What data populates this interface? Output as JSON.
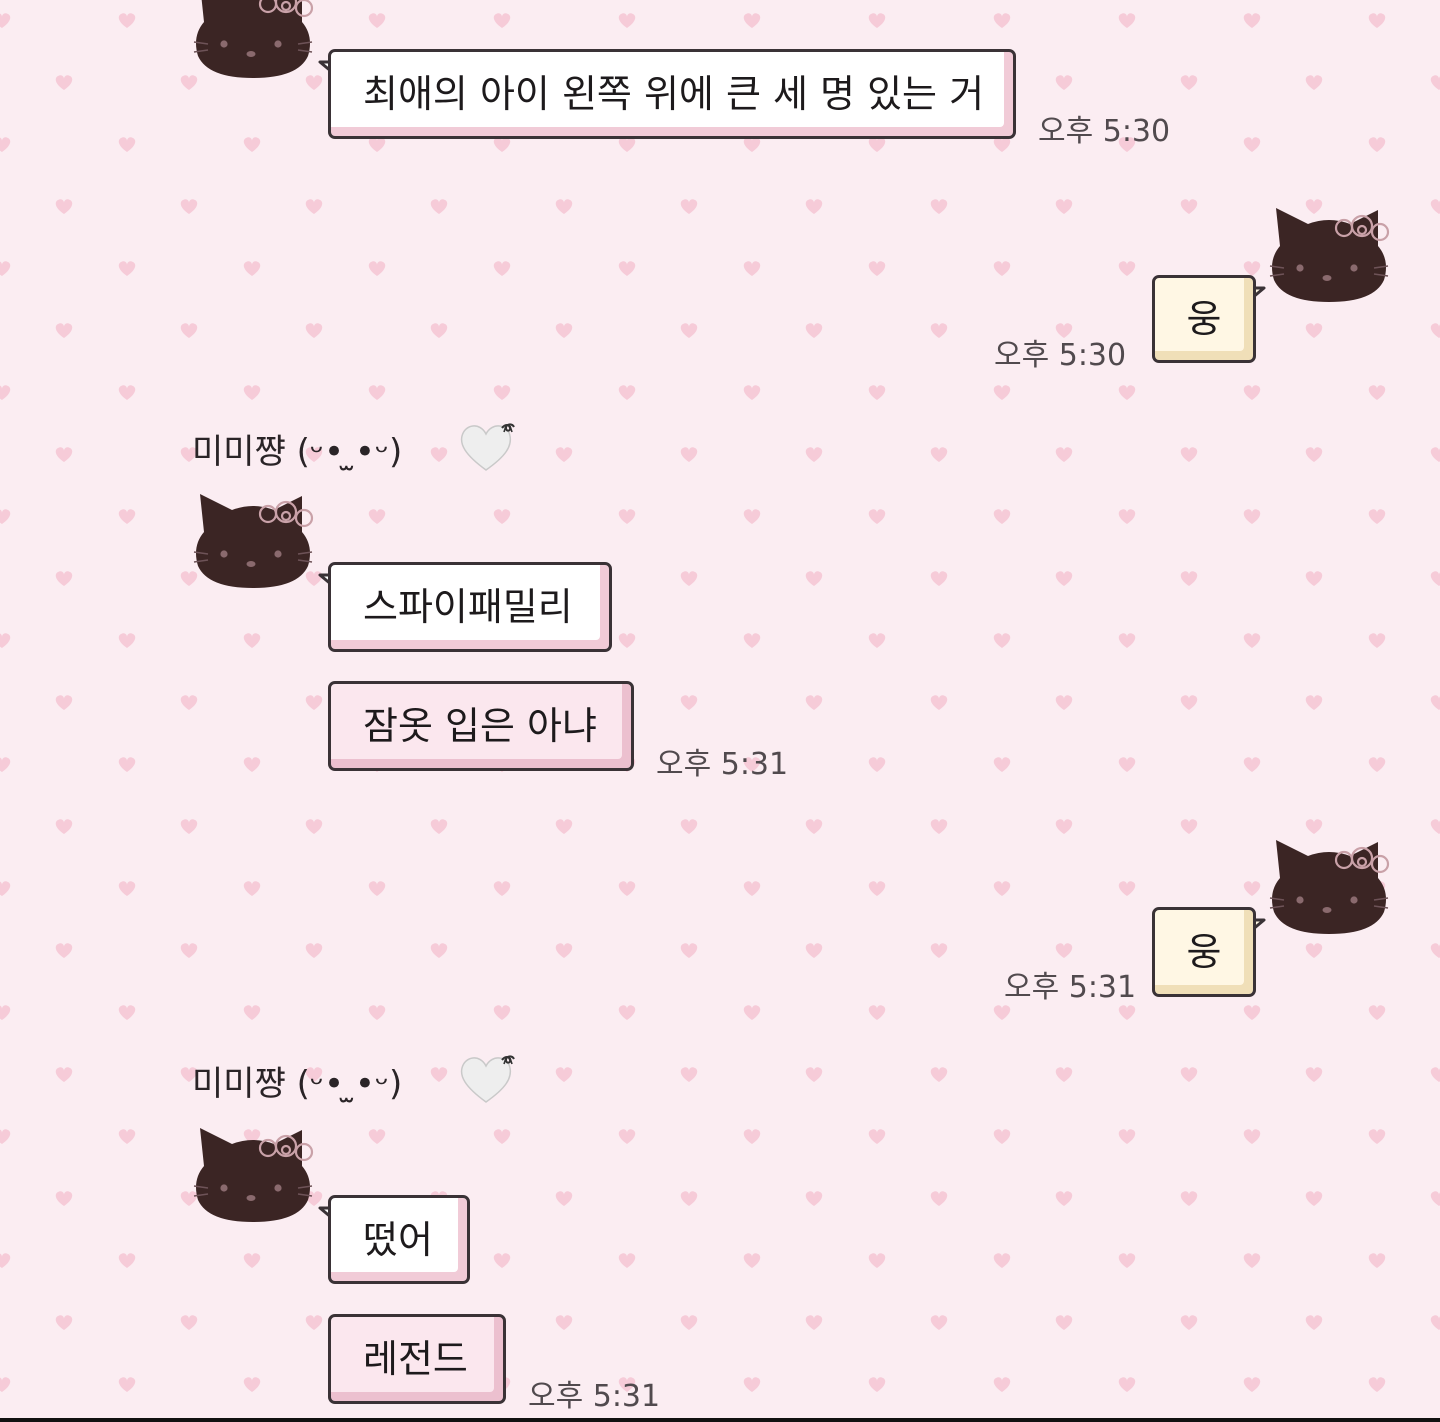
{
  "theme": {
    "background": "#fbedf2",
    "pattern_heart": "#f6cbd8",
    "avatar_color": "#3b2524",
    "bubble_border": "#3a3236"
  },
  "messages": [
    {
      "id": "m1",
      "side": "left",
      "style": "white",
      "text": "최애의 아이 왼쪽 위에 큰 세 명 있는 거",
      "time": "오후 5:30"
    },
    {
      "id": "m2",
      "side": "right",
      "style": "cream",
      "text": "웅",
      "time": "오후 5:30"
    },
    {
      "id": "m3",
      "side": "left",
      "style": "white",
      "sender": "미미쨩 (ᵕ• ̫•ᵕ)",
      "text": "스파이패밀리"
    },
    {
      "id": "m4",
      "side": "left",
      "style": "pink",
      "text": "잠옷 입은 아냐",
      "time": "오후 5:31"
    },
    {
      "id": "m5",
      "side": "right",
      "style": "cream",
      "text": "웅",
      "time": "오후 5:31"
    },
    {
      "id": "m6",
      "side": "left",
      "style": "white",
      "sender": "미미쨩 (ᵕ• ̫•ᵕ)",
      "text": "떴어"
    },
    {
      "id": "m7",
      "side": "left",
      "style": "pink",
      "text": "레전드",
      "time": "오후 5:31"
    }
  ]
}
